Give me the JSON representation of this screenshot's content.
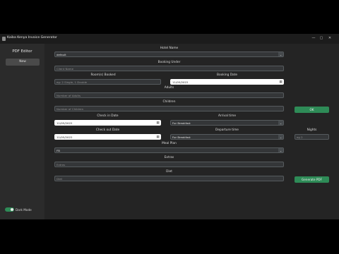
{
  "window": {
    "title": "Kaiba Kenya Invoice Generator",
    "minimize": "—",
    "maximize": "▢",
    "close": "✕"
  },
  "sidebar": {
    "title": "PDF Editor",
    "new_button": "New",
    "dark_mode_label": "Dark Mode",
    "dark_mode_on": true
  },
  "form": {
    "hotel_name": {
      "label": "Hotel Name",
      "value": "default"
    },
    "booking_under": {
      "label": "Booking Under",
      "placeholder": "Client Name"
    },
    "rooms_booked": {
      "label": "Room(s) Booked",
      "placeholder": "eg: 2 Single, 1 Double"
    },
    "booking_date": {
      "label": "Booking Date",
      "value": "11/05/2022"
    },
    "adults": {
      "label": "Adults",
      "placeholder": "Number of Adults"
    },
    "children": {
      "label": "Children",
      "placeholder": "Number of Children"
    },
    "ok_button": "OK",
    "check_in_date": {
      "label": "Check in Date",
      "value": "11/05/2022"
    },
    "arrival_time": {
      "label": "Arrival time",
      "value": "For Breakfast"
    },
    "check_out_date": {
      "label": "Check out Date",
      "value": "11/05/2022"
    },
    "departure_time": {
      "label": "Departure time",
      "value": "For Breakfast"
    },
    "nights": {
      "label": "Nights",
      "placeholder": "eg 2"
    },
    "meal_plan": {
      "label": "Meal Plan",
      "value": "FB"
    },
    "extras": {
      "label": "Extras",
      "placeholder": "Extras"
    },
    "diet": {
      "label": "Diet",
      "placeholder": "Diet"
    },
    "generate_button": "Generate PDF"
  },
  "icons": {
    "dropdown": "chevron-down-icon",
    "calendar": "calendar-icon"
  },
  "colors": {
    "accent": "#2e8b57",
    "background": "#242424",
    "sidebar": "#2b2b2b",
    "field": "#343638"
  }
}
